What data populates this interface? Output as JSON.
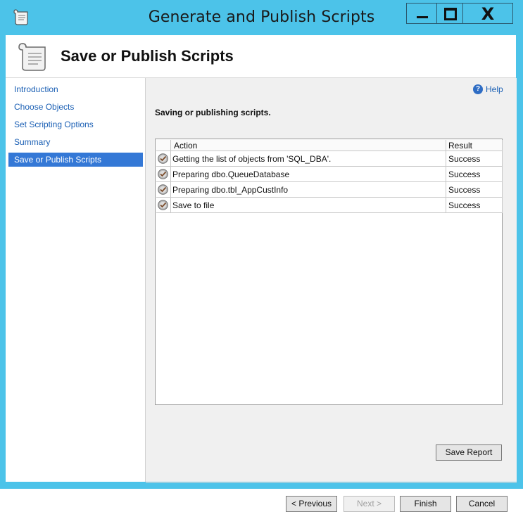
{
  "window": {
    "title": "Generate and Publish Scripts",
    "close_glyph": "X"
  },
  "header": {
    "title": "Save or Publish Scripts"
  },
  "nav": {
    "items": [
      {
        "label": "Introduction",
        "selected": false
      },
      {
        "label": "Choose Objects",
        "selected": false
      },
      {
        "label": "Set Scripting Options",
        "selected": false
      },
      {
        "label": "Summary",
        "selected": false
      },
      {
        "label": "Save or Publish Scripts",
        "selected": true
      }
    ]
  },
  "content": {
    "help_label": "Help",
    "subtitle": "Saving or publishing scripts.",
    "grid": {
      "columns": [
        "Action",
        "Result"
      ],
      "rows": [
        {
          "action": "Getting the list of objects from 'SQL_DBA'.",
          "result": "Success",
          "icon": "success-icon"
        },
        {
          "action": "Preparing dbo.QueueDatabase",
          "result": "Success",
          "icon": "success-icon"
        },
        {
          "action": "Preparing dbo.tbl_AppCustInfo",
          "result": "Success",
          "icon": "success-icon"
        },
        {
          "action": "Save to file",
          "result": "Success",
          "icon": "success-icon"
        }
      ]
    },
    "save_report_label": "Save Report"
  },
  "footer": {
    "previous_label": "< Previous",
    "next_label": "Next >",
    "finish_label": "Finish",
    "cancel_label": "Cancel"
  },
  "colors": {
    "titlebar": "#4cc3e9",
    "selection": "#3478d6",
    "link": "#1a5fb4"
  }
}
